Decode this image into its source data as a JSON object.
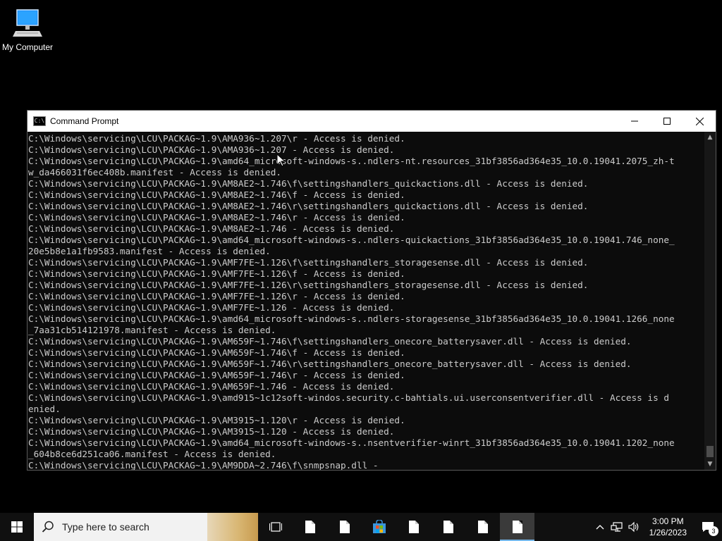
{
  "desktop": {
    "icons": [
      {
        "label": "My Computer",
        "icon": "computer-icon"
      }
    ]
  },
  "window": {
    "title": "Command Prompt",
    "icon": "cmd-icon",
    "icon_text": "C:\\",
    "controls": [
      "minimize-icon",
      "maximize-icon",
      "close-icon"
    ]
  },
  "console": {
    "lines": [
      "C:\\Windows\\servicing\\LCU\\PACKAG~1.9\\AMA936~1.207\\r - Access is denied.",
      "C:\\Windows\\servicing\\LCU\\PACKAG~1.9\\AMA936~1.207 - Access is denied.",
      "C:\\Windows\\servicing\\LCU\\PACKAG~1.9\\amd64_microsoft-windows-s..ndlers-nt.resources_31bf3856ad364e35_10.0.19041.2075_zh-t",
      "w_da466031f6ec408b.manifest - Access is denied.",
      "C:\\Windows\\servicing\\LCU\\PACKAG~1.9\\AM8AE2~1.746\\f\\settingshandlers_quickactions.dll - Access is denied.",
      "C:\\Windows\\servicing\\LCU\\PACKAG~1.9\\AM8AE2~1.746\\f - Access is denied.",
      "C:\\Windows\\servicing\\LCU\\PACKAG~1.9\\AM8AE2~1.746\\r\\settingshandlers_quickactions.dll - Access is denied.",
      "C:\\Windows\\servicing\\LCU\\PACKAG~1.9\\AM8AE2~1.746\\r - Access is denied.",
      "C:\\Windows\\servicing\\LCU\\PACKAG~1.9\\AM8AE2~1.746 - Access is denied.",
      "C:\\Windows\\servicing\\LCU\\PACKAG~1.9\\amd64_microsoft-windows-s..ndlers-quickactions_31bf3856ad364e35_10.0.19041.746_none_",
      "20e5b8e1a1fb9583.manifest - Access is denied.",
      "C:\\Windows\\servicing\\LCU\\PACKAG~1.9\\AMF7FE~1.126\\f\\settingshandlers_storagesense.dll - Access is denied.",
      "C:\\Windows\\servicing\\LCU\\PACKAG~1.9\\AMF7FE~1.126\\f - Access is denied.",
      "C:\\Windows\\servicing\\LCU\\PACKAG~1.9\\AMF7FE~1.126\\r\\settingshandlers_storagesense.dll - Access is denied.",
      "C:\\Windows\\servicing\\LCU\\PACKAG~1.9\\AMF7FE~1.126\\r - Access is denied.",
      "C:\\Windows\\servicing\\LCU\\PACKAG~1.9\\AMF7FE~1.126 - Access is denied.",
      "C:\\Windows\\servicing\\LCU\\PACKAG~1.9\\amd64_microsoft-windows-s..ndlers-storagesense_31bf3856ad364e35_10.0.19041.1266_none",
      "_7aa31cb514121978.manifest - Access is denied.",
      "C:\\Windows\\servicing\\LCU\\PACKAG~1.9\\AM659F~1.746\\f\\settingshandlers_onecore_batterysaver.dll - Access is denied.",
      "C:\\Windows\\servicing\\LCU\\PACKAG~1.9\\AM659F~1.746\\f - Access is denied.",
      "C:\\Windows\\servicing\\LCU\\PACKAG~1.9\\AM659F~1.746\\r\\settingshandlers_onecore_batterysaver.dll - Access is denied.",
      "C:\\Windows\\servicing\\LCU\\PACKAG~1.9\\AM659F~1.746\\r - Access is denied.",
      "C:\\Windows\\servicing\\LCU\\PACKAG~1.9\\AM659F~1.746 - Access is denied.",
      "C:\\Windows\\servicing\\LCU\\PACKAG~1.9\\amd915~1c12soft-windos.security.c-bahtials.ui.userconsentverifier.dll - Access is d",
      "enied.",
      "C:\\Windows\\servicing\\LCU\\PACKAG~1.9\\AM3915~1.120\\r - Access is denied.",
      "C:\\Windows\\servicing\\LCU\\PACKAG~1.9\\AM3915~1.120 - Access is denied.",
      "C:\\Windows\\servicing\\LCU\\PACKAG~1.9\\amd64_microsoft-windows-s..nsentverifier-winrt_31bf3856ad364e35_10.0.19041.1202_none",
      "_604b8ce6d251ca06.manifest - Access is denied.",
      "C:\\Windows\\servicing\\LCU\\PACKAG~1.9\\AM9DDA~2.746\\f\\snmpsnap.dll -"
    ]
  },
  "taskbar": {
    "start_icon": "windows-logo-icon",
    "search_placeholder": "Type here to search",
    "search_icon": "search-icon",
    "buttons": [
      {
        "icon": "task-view-icon"
      },
      {
        "icon": "document-icon"
      },
      {
        "icon": "document-icon"
      },
      {
        "icon": "store-icon"
      },
      {
        "icon": "document-icon"
      },
      {
        "icon": "document-icon"
      },
      {
        "icon": "document-icon"
      },
      {
        "icon": "document-icon",
        "active": true
      }
    ],
    "tray": {
      "icons": [
        "chevron-up-icon",
        "network-icon",
        "volume-icon"
      ],
      "time": "3:00 PM",
      "date": "1/26/2023",
      "notification_count": "3"
    }
  }
}
